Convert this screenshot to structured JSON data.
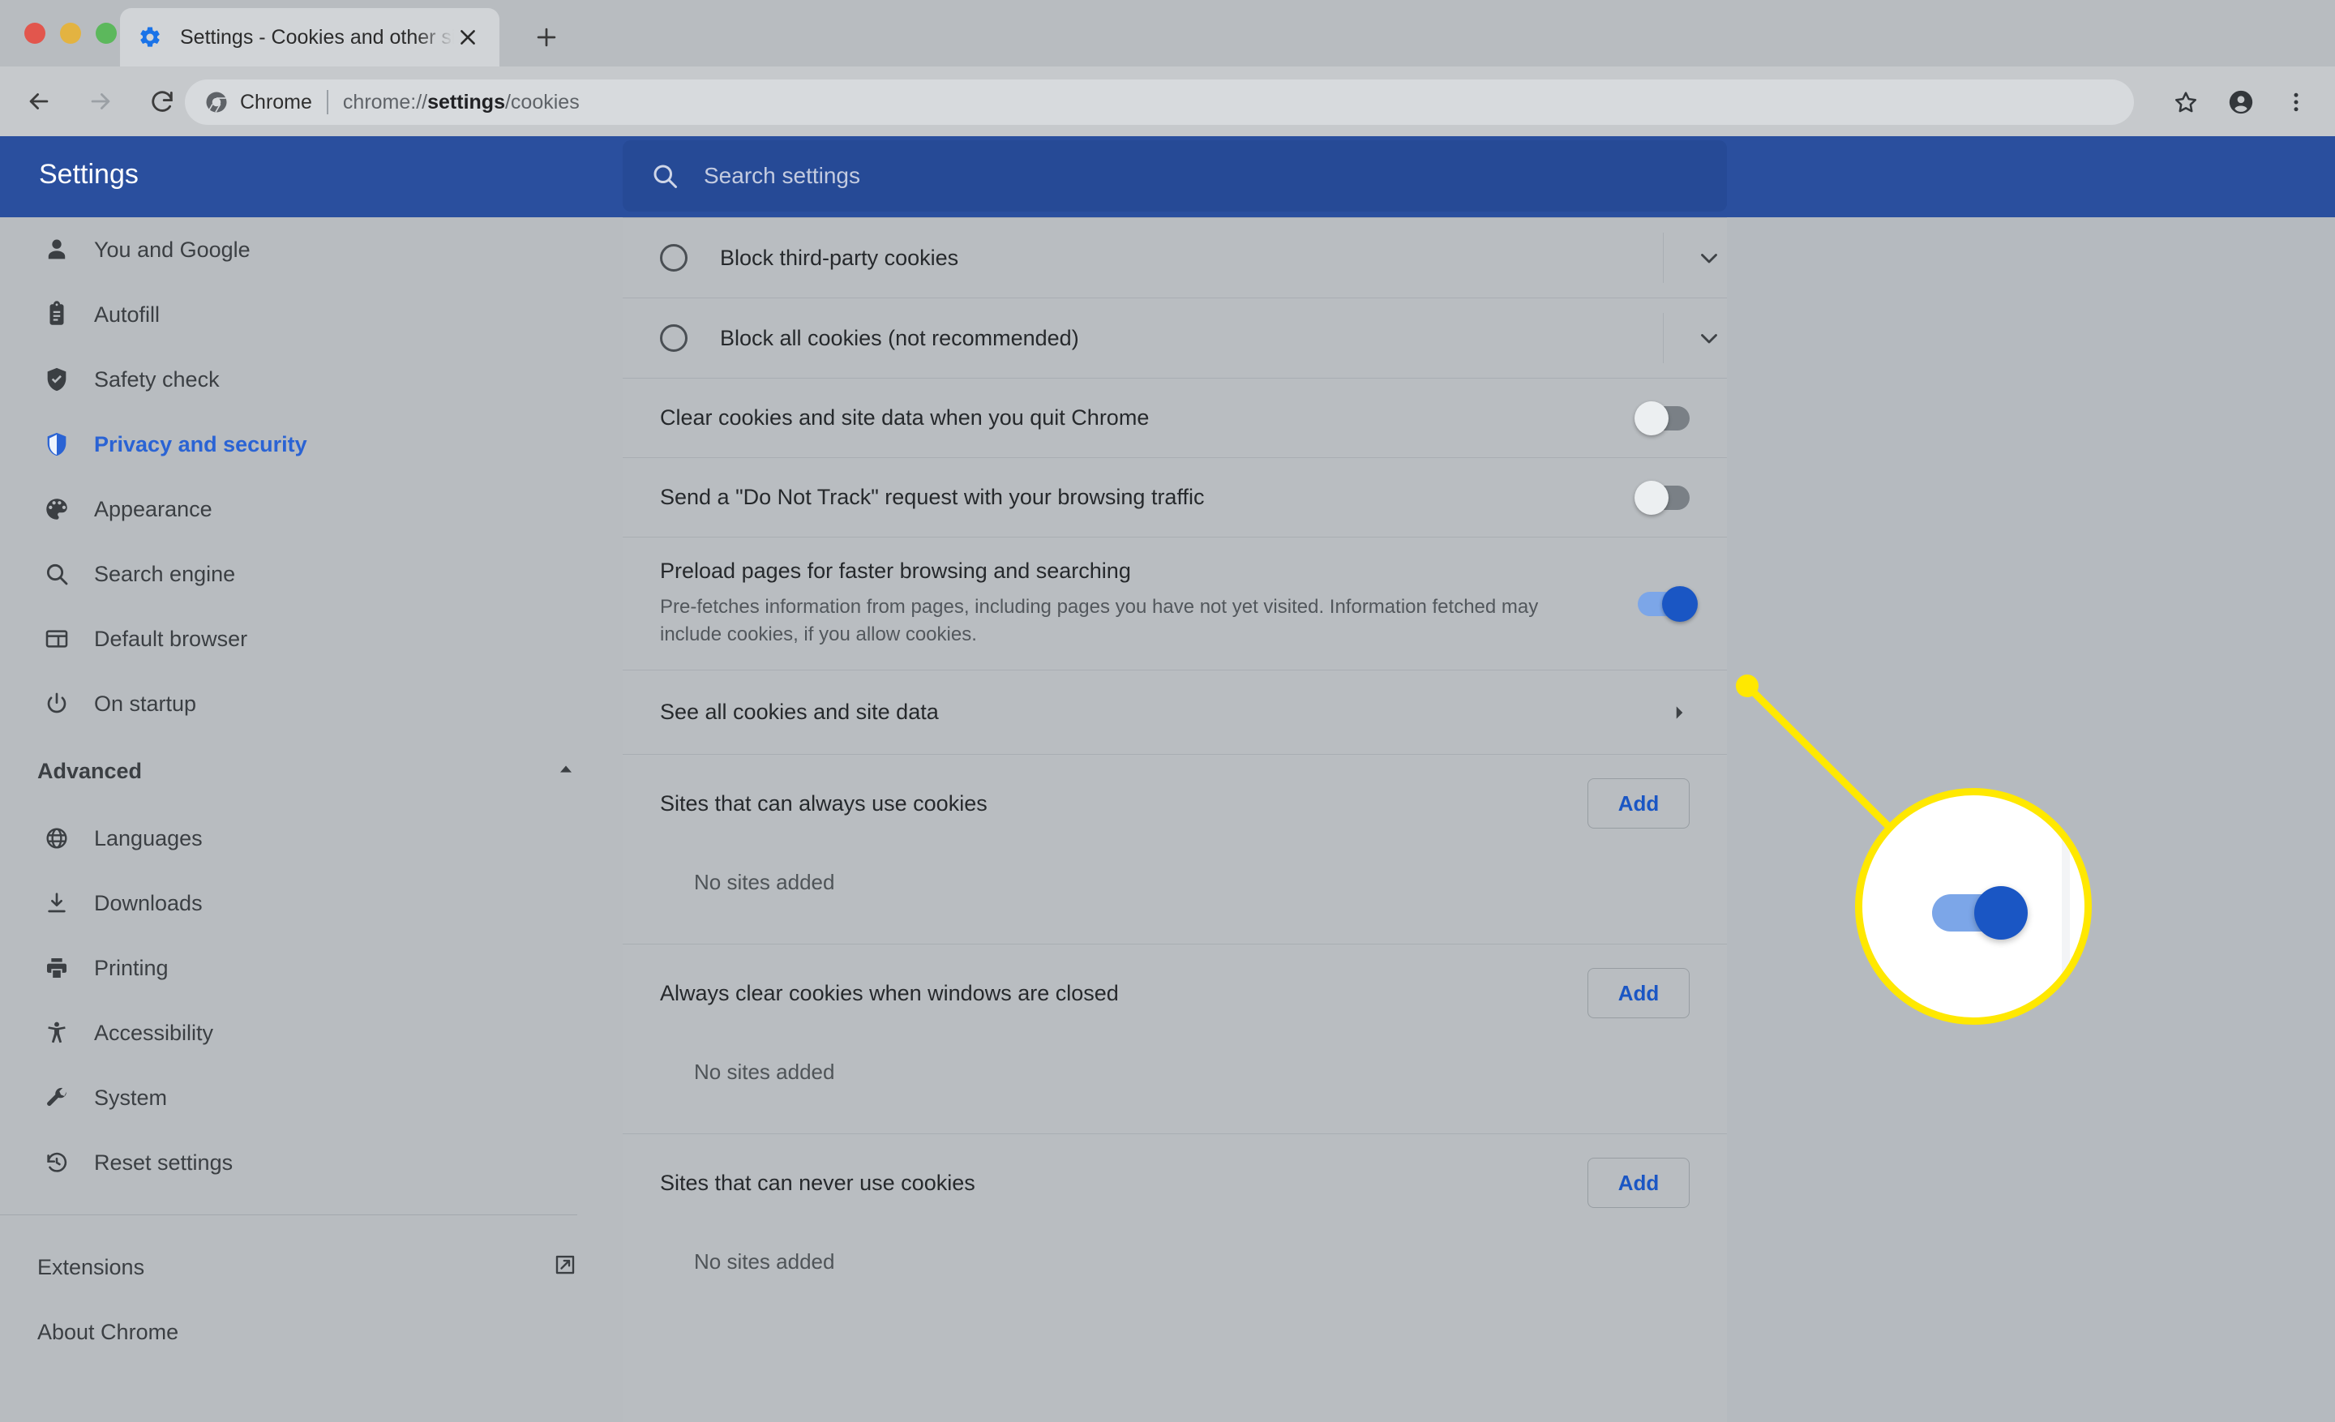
{
  "browser": {
    "tab": {
      "title": "Settings - Cookies and other si",
      "favicon_icon": "gear-icon",
      "close_icon": "close-icon"
    },
    "new_tab_label": "+",
    "toolbar": {
      "back_icon": "back-arrow-icon",
      "forward_icon": "forward-arrow-icon",
      "reload_icon": "reload-icon",
      "origin_badge_icon": "chrome-logo-icon",
      "origin": "Chrome",
      "url_prefix": "chrome://",
      "url_bold": "settings",
      "url_suffix": "/cookies",
      "bookmark_icon": "star-icon",
      "profile_icon": "account-avatar-icon",
      "menu_icon": "three-dot-menu-icon"
    },
    "window_controls": [
      "close-traffic-light",
      "minimize-traffic-light",
      "maximize-traffic-light"
    ]
  },
  "settings_header": {
    "title": "Settings",
    "search": {
      "icon": "search-icon",
      "placeholder": "Search settings",
      "value": ""
    },
    "background_color": "#2a4f9e"
  },
  "sidebar": {
    "items": [
      {
        "label": "You and Google",
        "icon": "person-icon",
        "active": false
      },
      {
        "label": "Autofill",
        "icon": "clipboard-icon",
        "active": false
      },
      {
        "label": "Safety check",
        "icon": "shield-check-icon",
        "active": false
      },
      {
        "label": "Privacy and security",
        "icon": "shield-icon",
        "active": true
      },
      {
        "label": "Appearance",
        "icon": "palette-icon",
        "active": false
      },
      {
        "label": "Search engine",
        "icon": "search-icon",
        "active": false
      },
      {
        "label": "Default browser",
        "icon": "browser-window-icon",
        "active": false
      },
      {
        "label": "On startup",
        "icon": "power-icon",
        "active": false
      }
    ],
    "advanced": {
      "label": "Advanced",
      "expanded": true,
      "chevron_icon": "chevron-up-icon",
      "items": [
        {
          "label": "Languages",
          "icon": "globe-icon"
        },
        {
          "label": "Downloads",
          "icon": "download-icon"
        },
        {
          "label": "Printing",
          "icon": "printer-icon"
        },
        {
          "label": "Accessibility",
          "icon": "accessibility-icon"
        },
        {
          "label": "System",
          "icon": "wrench-icon"
        },
        {
          "label": "Reset settings",
          "icon": "history-restore-icon"
        }
      ]
    },
    "footer": [
      {
        "label": "Extensions",
        "icon": "external-link-icon"
      },
      {
        "label": "About Chrome",
        "icon": ""
      }
    ],
    "accent_color": "#2a63d4"
  },
  "main": {
    "radio_options": [
      {
        "label": "Block third-party cookies",
        "selected": false,
        "expand_icon": "chevron-down-icon"
      },
      {
        "label": "Block all cookies (not recommended)",
        "selected": false,
        "expand_icon": "chevron-down-icon"
      }
    ],
    "toggles": [
      {
        "title": "Clear cookies and site data when you quit Chrome",
        "description": "",
        "state": "off"
      },
      {
        "title": "Send a \"Do Not Track\" request with your browsing traffic",
        "description": "",
        "state": "off"
      },
      {
        "title": "Preload pages for faster browsing and searching",
        "description": "Pre-fetches information from pages, including pages you have not yet visited. Information fetched may include cookies, if you allow cookies.",
        "state": "on"
      }
    ],
    "see_all": {
      "label": "See all cookies and site data",
      "arrow_icon": "chevron-right-icon"
    },
    "site_groups": [
      {
        "title": "Sites that can always use cookies",
        "add_label": "Add",
        "empty": "No sites added"
      },
      {
        "title": "Always clear cookies when windows are closed",
        "add_label": "Add",
        "empty": "No sites added"
      },
      {
        "title": "Sites that can never use cookies",
        "add_label": "Add",
        "empty": "No sites added"
      }
    ]
  },
  "callout": {
    "highlight_color": "#ffe800",
    "target": "preload-pages-toggle",
    "magnified_state": "on"
  }
}
